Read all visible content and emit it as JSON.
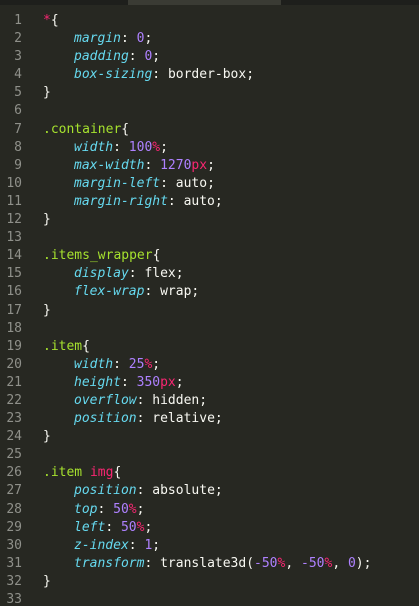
{
  "editor": {
    "line_numbers": [
      "1",
      "2",
      "3",
      "4",
      "5",
      "6",
      "7",
      "8",
      "9",
      "10",
      "11",
      "12",
      "13",
      "14",
      "15",
      "16",
      "17",
      "18",
      "19",
      "20",
      "21",
      "22",
      "23",
      "24",
      "25",
      "26",
      "27",
      "28",
      "29",
      "30",
      "31",
      "32",
      "33"
    ],
    "lines": [
      {
        "tokens": [
          {
            "t": "*",
            "c": "star"
          },
          {
            "t": "{",
            "c": "punc"
          }
        ]
      },
      {
        "indent": true,
        "tokens": [
          {
            "t": "margin",
            "c": "prop"
          },
          {
            "t": ": ",
            "c": "punc"
          },
          {
            "t": "0",
            "c": "num"
          },
          {
            "t": ";",
            "c": "punc"
          }
        ]
      },
      {
        "indent": true,
        "tokens": [
          {
            "t": "padding",
            "c": "prop"
          },
          {
            "t": ": ",
            "c": "punc"
          },
          {
            "t": "0",
            "c": "num"
          },
          {
            "t": ";",
            "c": "punc"
          }
        ]
      },
      {
        "indent": true,
        "tokens": [
          {
            "t": "box-sizing",
            "c": "prop"
          },
          {
            "t": ": ",
            "c": "punc"
          },
          {
            "t": "border-box",
            "c": "value"
          },
          {
            "t": ";",
            "c": "punc"
          }
        ]
      },
      {
        "tokens": [
          {
            "t": "}",
            "c": "punc"
          }
        ]
      },
      {
        "tokens": []
      },
      {
        "tokens": [
          {
            "t": ".container",
            "c": "selector"
          },
          {
            "t": "{",
            "c": "punc"
          }
        ]
      },
      {
        "indent": true,
        "tokens": [
          {
            "t": "width",
            "c": "prop"
          },
          {
            "t": ": ",
            "c": "punc"
          },
          {
            "t": "100",
            "c": "num"
          },
          {
            "t": "%",
            "c": "unit"
          },
          {
            "t": ";",
            "c": "punc"
          }
        ]
      },
      {
        "indent": true,
        "tokens": [
          {
            "t": "max-width",
            "c": "prop"
          },
          {
            "t": ": ",
            "c": "punc"
          },
          {
            "t": "1270",
            "c": "num"
          },
          {
            "t": "px",
            "c": "unit"
          },
          {
            "t": ";",
            "c": "punc"
          }
        ]
      },
      {
        "indent": true,
        "tokens": [
          {
            "t": "margin-left",
            "c": "prop"
          },
          {
            "t": ": ",
            "c": "punc"
          },
          {
            "t": "auto",
            "c": "value"
          },
          {
            "t": ";",
            "c": "punc"
          }
        ]
      },
      {
        "indent": true,
        "tokens": [
          {
            "t": "margin-right",
            "c": "prop"
          },
          {
            "t": ": ",
            "c": "punc"
          },
          {
            "t": "auto",
            "c": "value"
          },
          {
            "t": ";",
            "c": "punc"
          }
        ]
      },
      {
        "tokens": [
          {
            "t": "}",
            "c": "punc"
          }
        ]
      },
      {
        "tokens": []
      },
      {
        "tokens": [
          {
            "t": ".items_wrapper",
            "c": "selector"
          },
          {
            "t": "{",
            "c": "punc"
          }
        ]
      },
      {
        "indent": true,
        "tokens": [
          {
            "t": "display",
            "c": "prop"
          },
          {
            "t": ": ",
            "c": "punc"
          },
          {
            "t": "flex",
            "c": "value"
          },
          {
            "t": ";",
            "c": "punc"
          }
        ]
      },
      {
        "indent": true,
        "tokens": [
          {
            "t": "flex-wrap",
            "c": "prop"
          },
          {
            "t": ": ",
            "c": "punc"
          },
          {
            "t": "wrap",
            "c": "value"
          },
          {
            "t": ";",
            "c": "punc"
          }
        ]
      },
      {
        "tokens": [
          {
            "t": "}",
            "c": "punc"
          }
        ]
      },
      {
        "tokens": []
      },
      {
        "tokens": [
          {
            "t": ".item",
            "c": "selector"
          },
          {
            "t": "{",
            "c": "punc"
          }
        ]
      },
      {
        "indent": true,
        "tokens": [
          {
            "t": "width",
            "c": "prop"
          },
          {
            "t": ": ",
            "c": "punc"
          },
          {
            "t": "25",
            "c": "num"
          },
          {
            "t": "%",
            "c": "unit"
          },
          {
            "t": ";",
            "c": "punc"
          }
        ]
      },
      {
        "indent": true,
        "tokens": [
          {
            "t": "height",
            "c": "prop"
          },
          {
            "t": ": ",
            "c": "punc"
          },
          {
            "t": "350",
            "c": "num"
          },
          {
            "t": "px",
            "c": "unit"
          },
          {
            "t": ";",
            "c": "punc"
          }
        ]
      },
      {
        "indent": true,
        "tokens": [
          {
            "t": "overflow",
            "c": "prop"
          },
          {
            "t": ": ",
            "c": "punc"
          },
          {
            "t": "hidden",
            "c": "value"
          },
          {
            "t": ";",
            "c": "punc"
          }
        ]
      },
      {
        "indent": true,
        "tokens": [
          {
            "t": "position",
            "c": "prop"
          },
          {
            "t": ": ",
            "c": "punc"
          },
          {
            "t": "relative",
            "c": "value"
          },
          {
            "t": ";",
            "c": "punc"
          }
        ]
      },
      {
        "tokens": [
          {
            "t": "}",
            "c": "punc"
          }
        ]
      },
      {
        "tokens": []
      },
      {
        "tokens": [
          {
            "t": ".item",
            "c": "selector"
          },
          {
            "t": " ",
            "c": "punc"
          },
          {
            "t": "img",
            "c": "tag"
          },
          {
            "t": "{",
            "c": "punc"
          }
        ]
      },
      {
        "indent": true,
        "tokens": [
          {
            "t": "position",
            "c": "prop"
          },
          {
            "t": ": ",
            "c": "punc"
          },
          {
            "t": "absolute",
            "c": "value"
          },
          {
            "t": ";",
            "c": "punc"
          }
        ]
      },
      {
        "indent": true,
        "tokens": [
          {
            "t": "top",
            "c": "prop"
          },
          {
            "t": ": ",
            "c": "punc"
          },
          {
            "t": "50",
            "c": "num"
          },
          {
            "t": "%",
            "c": "unit"
          },
          {
            "t": ";",
            "c": "punc"
          }
        ]
      },
      {
        "indent": true,
        "tokens": [
          {
            "t": "left",
            "c": "prop"
          },
          {
            "t": ": ",
            "c": "punc"
          },
          {
            "t": "50",
            "c": "num"
          },
          {
            "t": "%",
            "c": "unit"
          },
          {
            "t": ";",
            "c": "punc"
          }
        ]
      },
      {
        "indent": true,
        "tokens": [
          {
            "t": "z-index",
            "c": "prop"
          },
          {
            "t": ": ",
            "c": "punc"
          },
          {
            "t": "1",
            "c": "num"
          },
          {
            "t": ";",
            "c": "punc"
          }
        ]
      },
      {
        "indent": true,
        "tokens": [
          {
            "t": "transform",
            "c": "prop"
          },
          {
            "t": ": ",
            "c": "punc"
          },
          {
            "t": "translate3d(",
            "c": "value"
          },
          {
            "t": "-50",
            "c": "num"
          },
          {
            "t": "%",
            "c": "unit"
          },
          {
            "t": ", ",
            "c": "punc"
          },
          {
            "t": "-50",
            "c": "num"
          },
          {
            "t": "%",
            "c": "unit"
          },
          {
            "t": ", ",
            "c": "punc"
          },
          {
            "t": "0",
            "c": "num"
          },
          {
            "t": ");",
            "c": "punc"
          }
        ]
      },
      {
        "tokens": [
          {
            "t": "}",
            "c": "punc"
          }
        ]
      },
      {
        "tokens": []
      }
    ]
  },
  "colors": {
    "background": "#272822",
    "gutter": "#8f908a",
    "selector": "#a6e22e",
    "property": "#66d9ef",
    "number": "#ae81ff",
    "keyword": "#f92672",
    "text": "#f8f8f2"
  }
}
